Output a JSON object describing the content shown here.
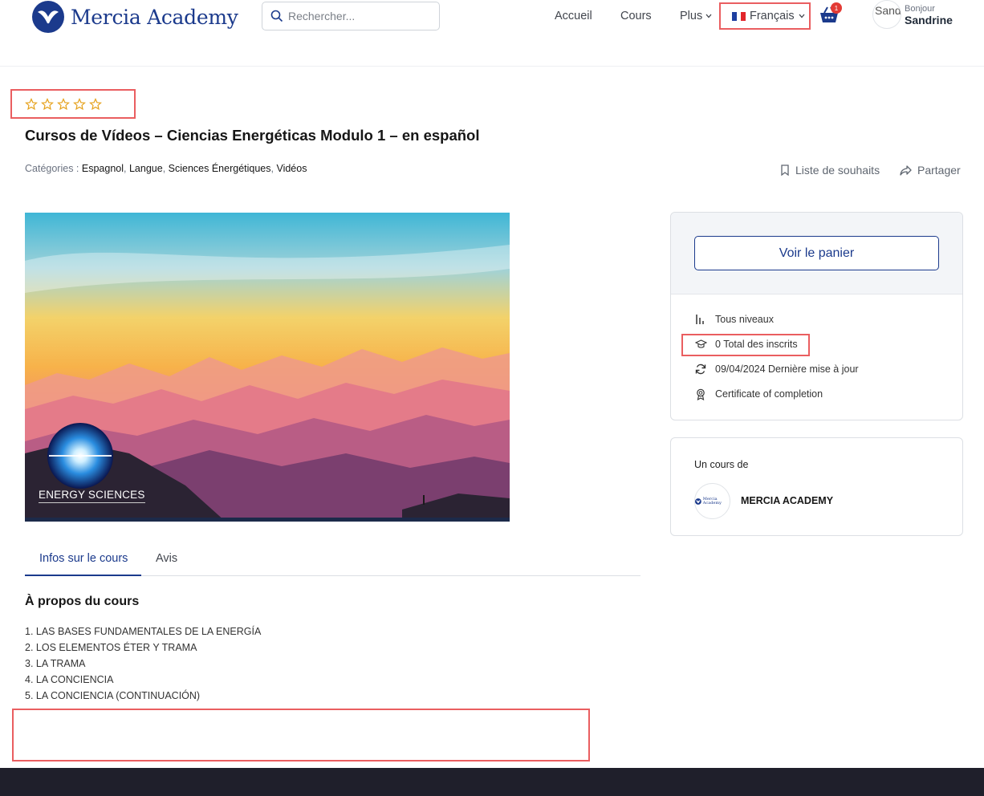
{
  "header": {
    "logo_text": "Mercia Academy",
    "search_placeholder": "Rechercher...",
    "nav": {
      "home": "Accueil",
      "courses": "Cours",
      "more": "Plus"
    },
    "language": "Français",
    "cart_count": "1",
    "user": {
      "avatar_text": "Sandrine",
      "greeting": "Bonjour",
      "name": "Sandrine"
    }
  },
  "course": {
    "rating_stars": 0,
    "title": "Cursos de Vídeos – Ciencias Energéticas Modulo 1 – en español",
    "categories_label": "Catégories :",
    "categories": [
      "Espagnol",
      "Langue",
      "Sciences Énergétiques",
      "Vidéos"
    ],
    "wishlist_label": "Liste de souhaits",
    "share_label": "Partager",
    "thumbnail_caption": "ENERGY SCIENCES"
  },
  "tabs": [
    "Infos sur le cours",
    "Avis"
  ],
  "about": {
    "title": "À propos du cours",
    "items": [
      "1. LAS BASES FUNDAMENTALES DE LA ENERGÍA",
      "2. LOS ELEMENTOS ÉTER Y TRAMA",
      "3. LA TRAMA",
      "4. LA CONCIENCIA",
      "5. LA CONCIENCIA (CONTINUACIÓN)"
    ]
  },
  "sidebar": {
    "cart_button": "Voir le panier",
    "meta": {
      "level": "Tous niveaux",
      "enrolled": "0 Total des inscrits",
      "updated": "09/04/2024 Dernière mise à jour",
      "certificate": "Certificate of completion"
    },
    "by_label": "Un cours de",
    "org_name": "MERCIA ACADEMY"
  },
  "colors": {
    "brand": "#1b3a8c",
    "highlight": "#ea5e60",
    "star": "#e6a21c",
    "badge": "#e33b35"
  }
}
